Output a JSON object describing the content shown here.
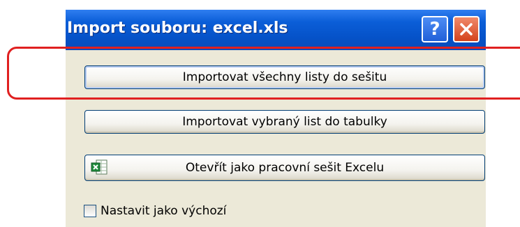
{
  "window": {
    "title": "Import souboru:  excel.xls",
    "help_glyph": "?"
  },
  "buttons": {
    "import_all": "Importovat všechny listy do sešitu",
    "import_selected": "Importovat vybraný list do tabulky",
    "open_excel": "Otevřít jako pracovní sešit Excelu"
  },
  "checkbox": {
    "label": "Nastavit jako výchozí",
    "checked": false
  },
  "icons": {
    "help": "help-icon",
    "close": "close-icon",
    "excel": "excel-file-icon"
  },
  "colors": {
    "titlebar": "#0552c8",
    "dialog_bg": "#ece9d8",
    "close_button": "#d4431c",
    "highlight": "#e02020"
  }
}
